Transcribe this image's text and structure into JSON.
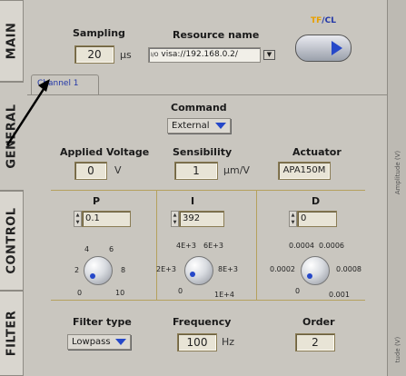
{
  "tabs": [
    "MAIN",
    "GENERAL",
    "CONTROL",
    "FILTER"
  ],
  "sampling": {
    "label": "Sampling",
    "value": "20",
    "unit": "µs"
  },
  "resource": {
    "label": "Resource name",
    "icon_prefix": "I/O",
    "value": "visa://192.168.0.2/"
  },
  "toggle": {
    "label_left": "TF",
    "label_sep": "/",
    "label_right": "CL"
  },
  "channel_tab": "Channel 1",
  "command": {
    "label": "Command",
    "value": "External"
  },
  "applied_voltage": {
    "label": "Applied Voltage",
    "value": "0",
    "unit": "V"
  },
  "sensibility": {
    "label": "Sensibility",
    "value": "1",
    "unit": "µm/V"
  },
  "actuator": {
    "label": "Actuator",
    "value": "APA150M"
  },
  "pid": {
    "p": {
      "label": "P",
      "value": "0.1",
      "ticks": [
        "0",
        "2",
        "4",
        "6",
        "8",
        "10"
      ]
    },
    "i": {
      "label": "I",
      "value": "392",
      "ticks": [
        "0",
        "2E+3",
        "4E+3",
        "6E+3",
        "8E+3",
        "1E+4"
      ]
    },
    "d": {
      "label": "D",
      "value": "0",
      "ticks": [
        "0",
        "0.0002",
        "0.0004",
        "0.0006",
        "0.0008",
        "0.001"
      ]
    }
  },
  "filter_type": {
    "label": "Filter type",
    "value": "Lowpass"
  },
  "frequency": {
    "label": "Frequency",
    "value": "100",
    "unit": "Hz"
  },
  "order": {
    "label": "Order",
    "value": "2"
  },
  "right_strip": {
    "top_label": "Amplitude (V)",
    "bottom_label": "tude (V)"
  },
  "colors": {
    "accent_blue": "#2648c9",
    "toggle_tf": "#e8a000",
    "tab_text": "#2136a7"
  }
}
